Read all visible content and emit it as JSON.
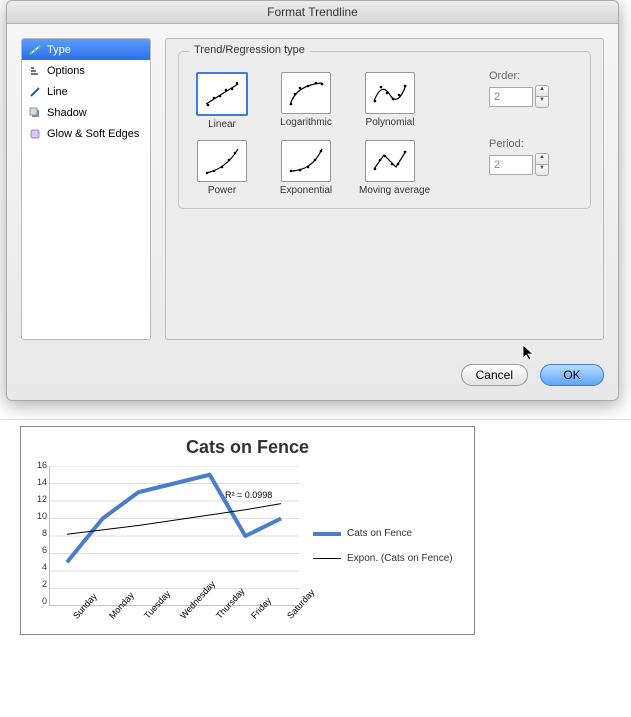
{
  "dialog": {
    "title": "Format Trendline",
    "sidebar": {
      "items": [
        {
          "label": "Type",
          "icon": "type-icon",
          "selected": true
        },
        {
          "label": "Options",
          "icon": "options-icon",
          "selected": false
        },
        {
          "label": "Line",
          "icon": "line-icon",
          "selected": false
        },
        {
          "label": "Shadow",
          "icon": "shadow-icon",
          "selected": false
        },
        {
          "label": "Glow & Soft Edges",
          "icon": "glow-icon",
          "selected": false
        }
      ]
    },
    "group_title": "Trend/Regression type",
    "types": [
      {
        "label": "Linear",
        "selected": true
      },
      {
        "label": "Logarithmic"
      },
      {
        "label": "Polynomial"
      },
      {
        "label": "Power"
      },
      {
        "label": "Exponential"
      },
      {
        "label": "Moving average"
      }
    ],
    "order": {
      "label": "Order:",
      "value": "2"
    },
    "period": {
      "label": "Period:",
      "value": "2"
    },
    "cancel": "Cancel",
    "ok": "OK"
  },
  "chart_data": {
    "type": "line",
    "title": "Cats on Fence",
    "categories": [
      "Sunday",
      "Monday",
      "Tuesday",
      "Wednesday",
      "Thursday",
      "Friday",
      "Saturday"
    ],
    "series": [
      {
        "name": "Cats on Fence",
        "values": [
          5,
          10,
          13,
          14,
          15,
          8,
          10
        ],
        "color": "#4a7ecb",
        "width": 4
      },
      {
        "name": "Expon. (Cats on Fence)",
        "values": [
          8.2,
          8.7,
          9.2,
          9.8,
          10.4,
          11.0,
          11.7
        ],
        "color": "#000000",
        "width": 1
      }
    ],
    "ylabel": "",
    "xlabel": "",
    "ylim": [
      0,
      16
    ],
    "yticks": [
      0,
      2,
      4,
      6,
      8,
      10,
      12,
      14,
      16
    ],
    "annotation": "R² = 0.0998",
    "legend": [
      "Cats on Fence",
      "Expon. (Cats on Fence)"
    ]
  }
}
